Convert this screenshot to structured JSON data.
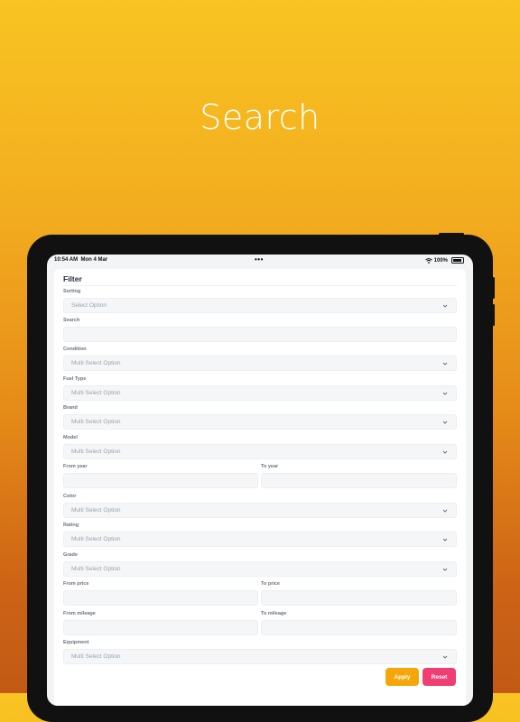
{
  "headline": "Search",
  "status_bar": {
    "time": "10:54 AM",
    "date": "Mon 4 Mar",
    "battery": "100%",
    "icons": [
      "wifi-icon",
      "battery-icon"
    ]
  },
  "filter": {
    "title": "Filter",
    "sorting": {
      "label": "Sorting",
      "placeholder": "Select Option"
    },
    "search": {
      "label": "Search",
      "value": ""
    },
    "condition": {
      "label": "Condition",
      "placeholder": "Multi Select Option"
    },
    "fuel_type": {
      "label": "Fuel Type",
      "placeholder": "Multi Select Option"
    },
    "brand": {
      "label": "Brand",
      "placeholder": "Multi Select Option"
    },
    "model": {
      "label": "Model",
      "placeholder": "Multi Select Option"
    },
    "from_year": {
      "label": "From year",
      "value": ""
    },
    "to_year": {
      "label": "To year",
      "value": ""
    },
    "color": {
      "label": "Color",
      "placeholder": "Multi Select Option"
    },
    "rating": {
      "label": "Rating",
      "placeholder": "Multi Select Option"
    },
    "grade": {
      "label": "Grade",
      "placeholder": "Multi Select Option"
    },
    "from_price": {
      "label": "From price",
      "value": ""
    },
    "to_price": {
      "label": "To price",
      "value": ""
    },
    "from_mileage": {
      "label": "From mileage",
      "value": ""
    },
    "to_mileage": {
      "label": "To mileage",
      "value": ""
    },
    "equipment": {
      "label": "Equipment",
      "placeholder": "Multi Select Option"
    },
    "apply_label": "Apply",
    "reset_label": "Reset"
  },
  "colors": {
    "apply": "#f5a70a",
    "reset": "#f03e73"
  }
}
